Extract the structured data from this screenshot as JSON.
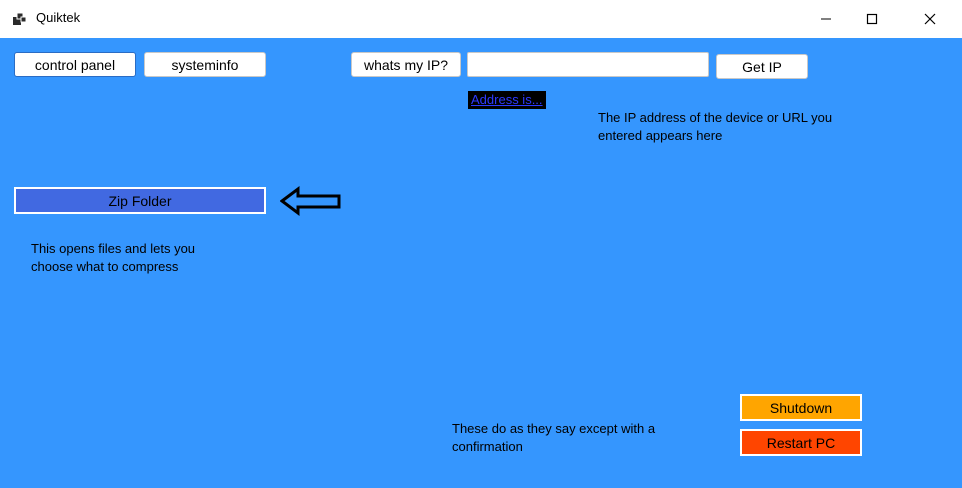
{
  "window": {
    "title": "Quiktek",
    "icon": "app-window-icon"
  },
  "titlebar_controls": {
    "minimize_icon": "minimize-icon",
    "maximize_icon": "maximize-icon",
    "close_icon": "close-icon"
  },
  "toolbar": {
    "control_panel_label": "control panel",
    "systeminfo_label": "systeminfo",
    "whats_my_ip_label": "whats my IP?",
    "ip_input_value": "",
    "get_ip_label": "Get IP"
  },
  "ip_section": {
    "address_link": "Address is...",
    "description": "The IP address of the device or URL you entered appears here",
    "description_line1": "The IP address of the device or URL you",
    "description_line2": "entered appears here"
  },
  "zip_section": {
    "zip_button_label": "Zip Folder",
    "arrow_icon": "left-arrow-icon",
    "description_line1": "This opens files and lets you",
    "description_line2": "choose what to compress"
  },
  "power_section": {
    "shutdown_label": "Shutdown",
    "restart_label": "Restart PC",
    "description_line1": "These do as they say except with a",
    "description_line2": "confirmation"
  },
  "colors": {
    "client_background": "#3596fe",
    "zip_button": "#4169e1",
    "shutdown_button": "#ffa500",
    "restart_button": "#ff4500",
    "address_link_background": "#000000",
    "address_link_text": "#2d3bff"
  }
}
